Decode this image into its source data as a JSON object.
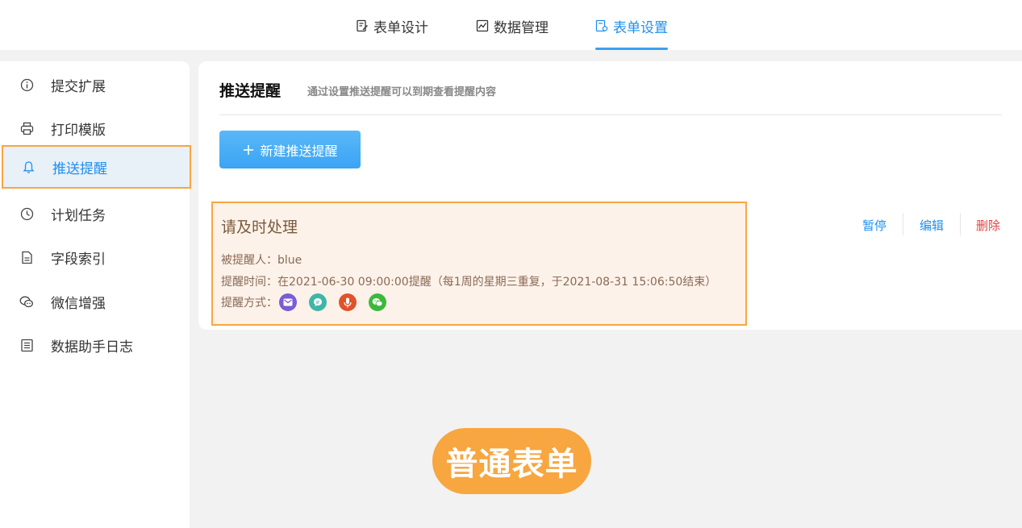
{
  "tabs": [
    {
      "label": "表单设计",
      "icon": "edit-icon",
      "active": false
    },
    {
      "label": "数据管理",
      "icon": "chart-icon",
      "active": false
    },
    {
      "label": "表单设置",
      "icon": "form-settings-icon",
      "active": true
    }
  ],
  "sidebar": {
    "items": [
      {
        "label": "提交扩展",
        "icon": "info-icon"
      },
      {
        "label": "打印模版",
        "icon": "printer-icon"
      },
      {
        "label": "推送提醒",
        "icon": "bell-icon",
        "active": true
      },
      {
        "label": "计划任务",
        "icon": "clock-icon"
      },
      {
        "label": "字段索引",
        "icon": "document-icon"
      },
      {
        "label": "微信增强",
        "icon": "wechat-icon"
      },
      {
        "label": "数据助手日志",
        "icon": "list-icon"
      }
    ]
  },
  "main": {
    "title": "推送提醒",
    "subtitle": "通过设置推送提醒可以到期查看提醒内容",
    "new_button": "新建推送提醒",
    "reminder": {
      "name": "请及时处理",
      "recipient_line": "被提醒人：blue",
      "time_line": "提醒时间：在2021-06-30 09:00:00提醒（每1周的星期三重复，于2021-08-31 15:06:50结束）",
      "method_label": "提醒方式：",
      "methods": [
        {
          "icon": "email-icon",
          "color": "#7b5bd6"
        },
        {
          "icon": "message-icon",
          "color": "#3fb6a8"
        },
        {
          "icon": "voice-icon",
          "color": "#e0522a"
        },
        {
          "icon": "wechat-icon",
          "color": "#3cb83c"
        }
      ]
    },
    "actions": {
      "pause": "暂停",
      "edit": "编辑",
      "delete": "删除"
    }
  },
  "badge": "普通表单",
  "colors": {
    "accent": "#1e90f0",
    "highlight": "#f7a640",
    "danger": "#e84040"
  }
}
